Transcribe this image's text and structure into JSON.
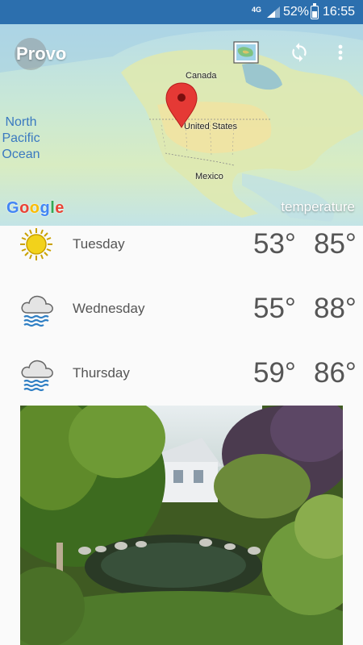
{
  "status_bar": {
    "network": "4G",
    "battery": "52%",
    "time": "16:55"
  },
  "map": {
    "city": "Provo",
    "labels": {
      "canada": "Canada",
      "united_states": "United States",
      "mexico": "Mexico",
      "ocean": "North Pacific Ocean"
    },
    "ocean_lines": [
      "North",
      "Pacific",
      "Ocean"
    ],
    "attribution": "Google",
    "layer": "temperature",
    "icons": [
      "map-layer-icon",
      "refresh-icon",
      "more-vert-icon",
      "location-pin-icon"
    ]
  },
  "forecast": [
    {
      "day": "Tuesday",
      "low": "53°",
      "high": "85°",
      "icon": "sun-icon"
    },
    {
      "day": "Wednesday",
      "low": "55°",
      "high": "88°",
      "icon": "rain-cloud-icon"
    },
    {
      "day": "Thursday",
      "low": "59°",
      "high": "86°",
      "icon": "rain-cloud-icon"
    }
  ],
  "colors": {
    "status_bar": "#2c6fae",
    "background": "#fafafa",
    "text": "#555555",
    "pin": "#e53935"
  }
}
